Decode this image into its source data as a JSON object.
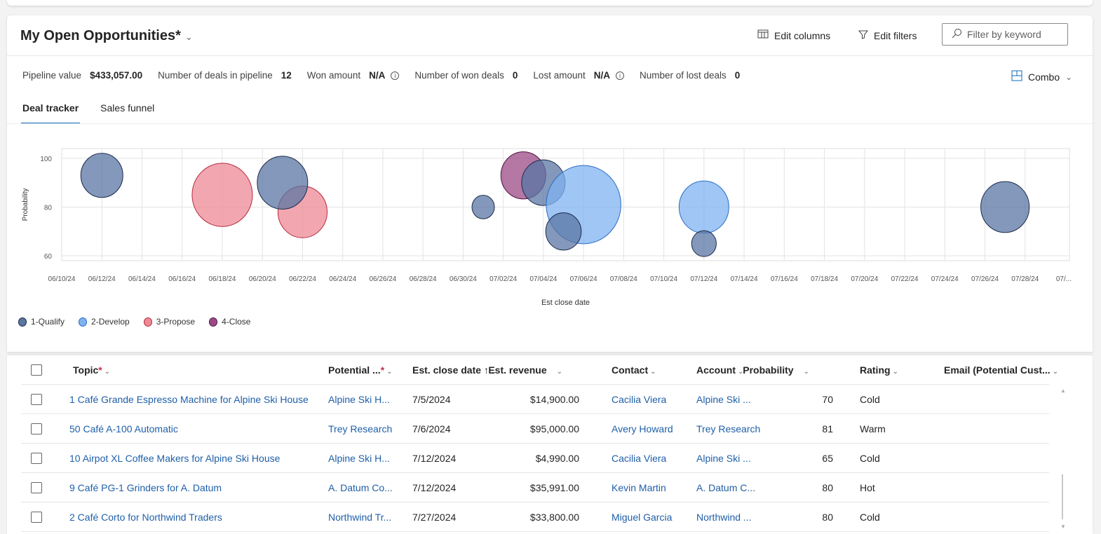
{
  "view": {
    "title": "My Open Opportunities*",
    "edit_columns": "Edit columns",
    "edit_filters": "Edit filters",
    "filter_placeholder": "Filter by keyword",
    "combo": "Combo"
  },
  "kpis": [
    {
      "label": "Pipeline value",
      "value": "$433,057.00"
    },
    {
      "label": "Number of deals in pipeline",
      "value": "12"
    },
    {
      "label": "Won amount",
      "value": "N/A",
      "info": true
    },
    {
      "label": "Number of won deals",
      "value": "0"
    },
    {
      "label": "Lost amount",
      "value": "N/A",
      "info": true
    },
    {
      "label": "Number of lost deals",
      "value": "0"
    }
  ],
  "tabs": [
    {
      "label": "Deal tracker",
      "active": true
    },
    {
      "label": "Sales funnel"
    }
  ],
  "chart_data": {
    "type": "bubble",
    "xlabel": "Est close date",
    "ylabel": "Probability",
    "ylim": [
      58,
      104
    ],
    "yticks": [
      "60",
      "80",
      "100"
    ],
    "xticks": [
      "06/10/24",
      "06/12/24",
      "06/14/24",
      "06/16/24",
      "06/18/24",
      "06/20/24",
      "06/22/24",
      "06/24/24",
      "06/26/24",
      "06/28/24",
      "06/30/24",
      "07/02/24",
      "07/04/24",
      "07/06/24",
      "07/08/24",
      "07/10/24",
      "07/12/24",
      "07/14/24",
      "07/16/24",
      "07/18/24",
      "07/20/24",
      "07/22/24",
      "07/24/24",
      "07/26/24",
      "07/28/24",
      "07/..."
    ],
    "grid": true,
    "legend_position": "bottom-left",
    "series": [
      {
        "name": "1-Qualify",
        "color": "#5a76a3",
        "stroke": "#1b2a4a",
        "points": [
          [
            "2024-06-12",
            93,
            23500
          ],
          [
            "2024-06-21",
            90,
            37300
          ],
          [
            "2024-07-01",
            80,
            3600
          ],
          [
            "2024-07-04",
            90,
            25600
          ],
          [
            "2024-07-05",
            70,
            14900
          ],
          [
            "2024-07-12",
            65,
            4990
          ],
          [
            "2024-07-27",
            80,
            33800
          ]
        ]
      },
      {
        "name": "2-Develop",
        "color": "#7fb3f0",
        "stroke": "#2b6cc4",
        "points": [
          [
            "2024-07-06",
            81,
            95000
          ],
          [
            "2024-07-12",
            80,
            35991
          ]
        ]
      },
      {
        "name": "3-Propose",
        "color": "#ee8a96",
        "stroke": "#b52a3e",
        "points": [
          [
            "2024-06-18",
            85,
            57600
          ],
          [
            "2024-06-22",
            78,
            35000
          ]
        ]
      },
      {
        "name": "4-Close",
        "color": "#9c4a86",
        "stroke": "#4c1444",
        "points": [
          [
            "2024-07-03",
            93,
            27800
          ]
        ]
      }
    ]
  },
  "table": {
    "headers": [
      "Topic",
      "Potential ...",
      "Est. close date",
      "Est. revenue",
      "Contact",
      "Account",
      "Probability",
      "Rating",
      "Email (Potential Cust..."
    ],
    "rows": [
      [
        "1 Café Grande Espresso Machine for Alpine Ski House",
        "Alpine Ski H...",
        "7/5/2024",
        "$14,900.00",
        "Cacilia Viera",
        "Alpine Ski ...",
        "70",
        "Cold"
      ],
      [
        "50 Café A-100 Automatic",
        "Trey Research",
        "7/6/2024",
        "$95,000.00",
        "Avery Howard",
        "Trey Research",
        "81",
        "Warm"
      ],
      [
        "10 Airpot XL Coffee Makers for Alpine Ski House",
        "Alpine Ski H...",
        "7/12/2024",
        "$4,990.00",
        "Cacilia Viera",
        "Alpine Ski ...",
        "65",
        "Cold"
      ],
      [
        "9 Café PG-1 Grinders for A. Datum",
        "A. Datum Co...",
        "7/12/2024",
        "$35,991.00",
        "Kevin Martin",
        "A. Datum C...",
        "80",
        "Hot"
      ],
      [
        "2 Café Corto for Northwind Traders",
        "Northwind Tr...",
        "7/27/2024",
        "$33,800.00",
        "Miguel Garcia",
        "Northwind ...",
        "80",
        "Cold"
      ]
    ]
  }
}
